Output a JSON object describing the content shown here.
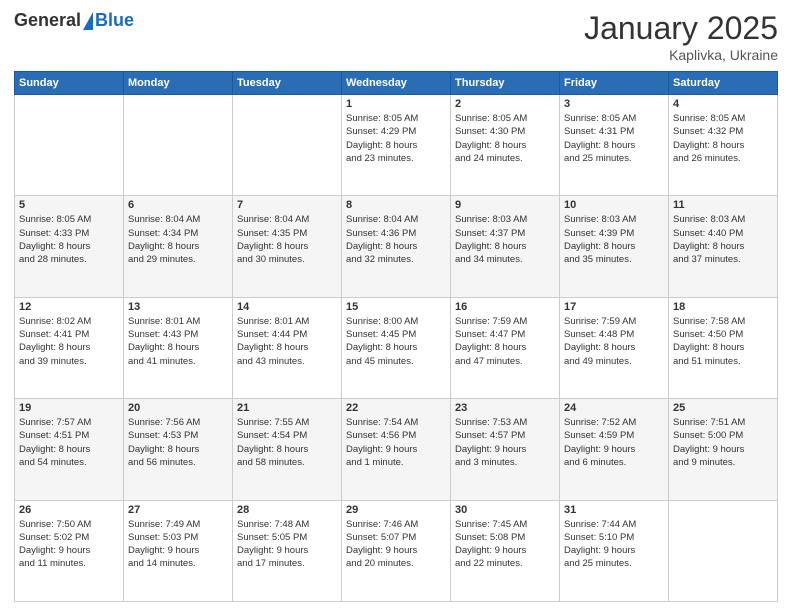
{
  "header": {
    "logo_general": "General",
    "logo_blue": "Blue",
    "month_title": "January 2025",
    "location": "Kaplivka, Ukraine"
  },
  "weekdays": [
    "Sunday",
    "Monday",
    "Tuesday",
    "Wednesday",
    "Thursday",
    "Friday",
    "Saturday"
  ],
  "weeks": [
    [
      {
        "day": "",
        "info": ""
      },
      {
        "day": "",
        "info": ""
      },
      {
        "day": "",
        "info": ""
      },
      {
        "day": "1",
        "info": "Sunrise: 8:05 AM\nSunset: 4:29 PM\nDaylight: 8 hours\nand 23 minutes."
      },
      {
        "day": "2",
        "info": "Sunrise: 8:05 AM\nSunset: 4:30 PM\nDaylight: 8 hours\nand 24 minutes."
      },
      {
        "day": "3",
        "info": "Sunrise: 8:05 AM\nSunset: 4:31 PM\nDaylight: 8 hours\nand 25 minutes."
      },
      {
        "day": "4",
        "info": "Sunrise: 8:05 AM\nSunset: 4:32 PM\nDaylight: 8 hours\nand 26 minutes."
      }
    ],
    [
      {
        "day": "5",
        "info": "Sunrise: 8:05 AM\nSunset: 4:33 PM\nDaylight: 8 hours\nand 28 minutes."
      },
      {
        "day": "6",
        "info": "Sunrise: 8:04 AM\nSunset: 4:34 PM\nDaylight: 8 hours\nand 29 minutes."
      },
      {
        "day": "7",
        "info": "Sunrise: 8:04 AM\nSunset: 4:35 PM\nDaylight: 8 hours\nand 30 minutes."
      },
      {
        "day": "8",
        "info": "Sunrise: 8:04 AM\nSunset: 4:36 PM\nDaylight: 8 hours\nand 32 minutes."
      },
      {
        "day": "9",
        "info": "Sunrise: 8:03 AM\nSunset: 4:37 PM\nDaylight: 8 hours\nand 34 minutes."
      },
      {
        "day": "10",
        "info": "Sunrise: 8:03 AM\nSunset: 4:39 PM\nDaylight: 8 hours\nand 35 minutes."
      },
      {
        "day": "11",
        "info": "Sunrise: 8:03 AM\nSunset: 4:40 PM\nDaylight: 8 hours\nand 37 minutes."
      }
    ],
    [
      {
        "day": "12",
        "info": "Sunrise: 8:02 AM\nSunset: 4:41 PM\nDaylight: 8 hours\nand 39 minutes."
      },
      {
        "day": "13",
        "info": "Sunrise: 8:01 AM\nSunset: 4:43 PM\nDaylight: 8 hours\nand 41 minutes."
      },
      {
        "day": "14",
        "info": "Sunrise: 8:01 AM\nSunset: 4:44 PM\nDaylight: 8 hours\nand 43 minutes."
      },
      {
        "day": "15",
        "info": "Sunrise: 8:00 AM\nSunset: 4:45 PM\nDaylight: 8 hours\nand 45 minutes."
      },
      {
        "day": "16",
        "info": "Sunrise: 7:59 AM\nSunset: 4:47 PM\nDaylight: 8 hours\nand 47 minutes."
      },
      {
        "day": "17",
        "info": "Sunrise: 7:59 AM\nSunset: 4:48 PM\nDaylight: 8 hours\nand 49 minutes."
      },
      {
        "day": "18",
        "info": "Sunrise: 7:58 AM\nSunset: 4:50 PM\nDaylight: 8 hours\nand 51 minutes."
      }
    ],
    [
      {
        "day": "19",
        "info": "Sunrise: 7:57 AM\nSunset: 4:51 PM\nDaylight: 8 hours\nand 54 minutes."
      },
      {
        "day": "20",
        "info": "Sunrise: 7:56 AM\nSunset: 4:53 PM\nDaylight: 8 hours\nand 56 minutes."
      },
      {
        "day": "21",
        "info": "Sunrise: 7:55 AM\nSunset: 4:54 PM\nDaylight: 8 hours\nand 58 minutes."
      },
      {
        "day": "22",
        "info": "Sunrise: 7:54 AM\nSunset: 4:56 PM\nDaylight: 9 hours\nand 1 minute."
      },
      {
        "day": "23",
        "info": "Sunrise: 7:53 AM\nSunset: 4:57 PM\nDaylight: 9 hours\nand 3 minutes."
      },
      {
        "day": "24",
        "info": "Sunrise: 7:52 AM\nSunset: 4:59 PM\nDaylight: 9 hours\nand 6 minutes."
      },
      {
        "day": "25",
        "info": "Sunrise: 7:51 AM\nSunset: 5:00 PM\nDaylight: 9 hours\nand 9 minutes."
      }
    ],
    [
      {
        "day": "26",
        "info": "Sunrise: 7:50 AM\nSunset: 5:02 PM\nDaylight: 9 hours\nand 11 minutes."
      },
      {
        "day": "27",
        "info": "Sunrise: 7:49 AM\nSunset: 5:03 PM\nDaylight: 9 hours\nand 14 minutes."
      },
      {
        "day": "28",
        "info": "Sunrise: 7:48 AM\nSunset: 5:05 PM\nDaylight: 9 hours\nand 17 minutes."
      },
      {
        "day": "29",
        "info": "Sunrise: 7:46 AM\nSunset: 5:07 PM\nDaylight: 9 hours\nand 20 minutes."
      },
      {
        "day": "30",
        "info": "Sunrise: 7:45 AM\nSunset: 5:08 PM\nDaylight: 9 hours\nand 22 minutes."
      },
      {
        "day": "31",
        "info": "Sunrise: 7:44 AM\nSunset: 5:10 PM\nDaylight: 9 hours\nand 25 minutes."
      },
      {
        "day": "",
        "info": ""
      }
    ]
  ]
}
